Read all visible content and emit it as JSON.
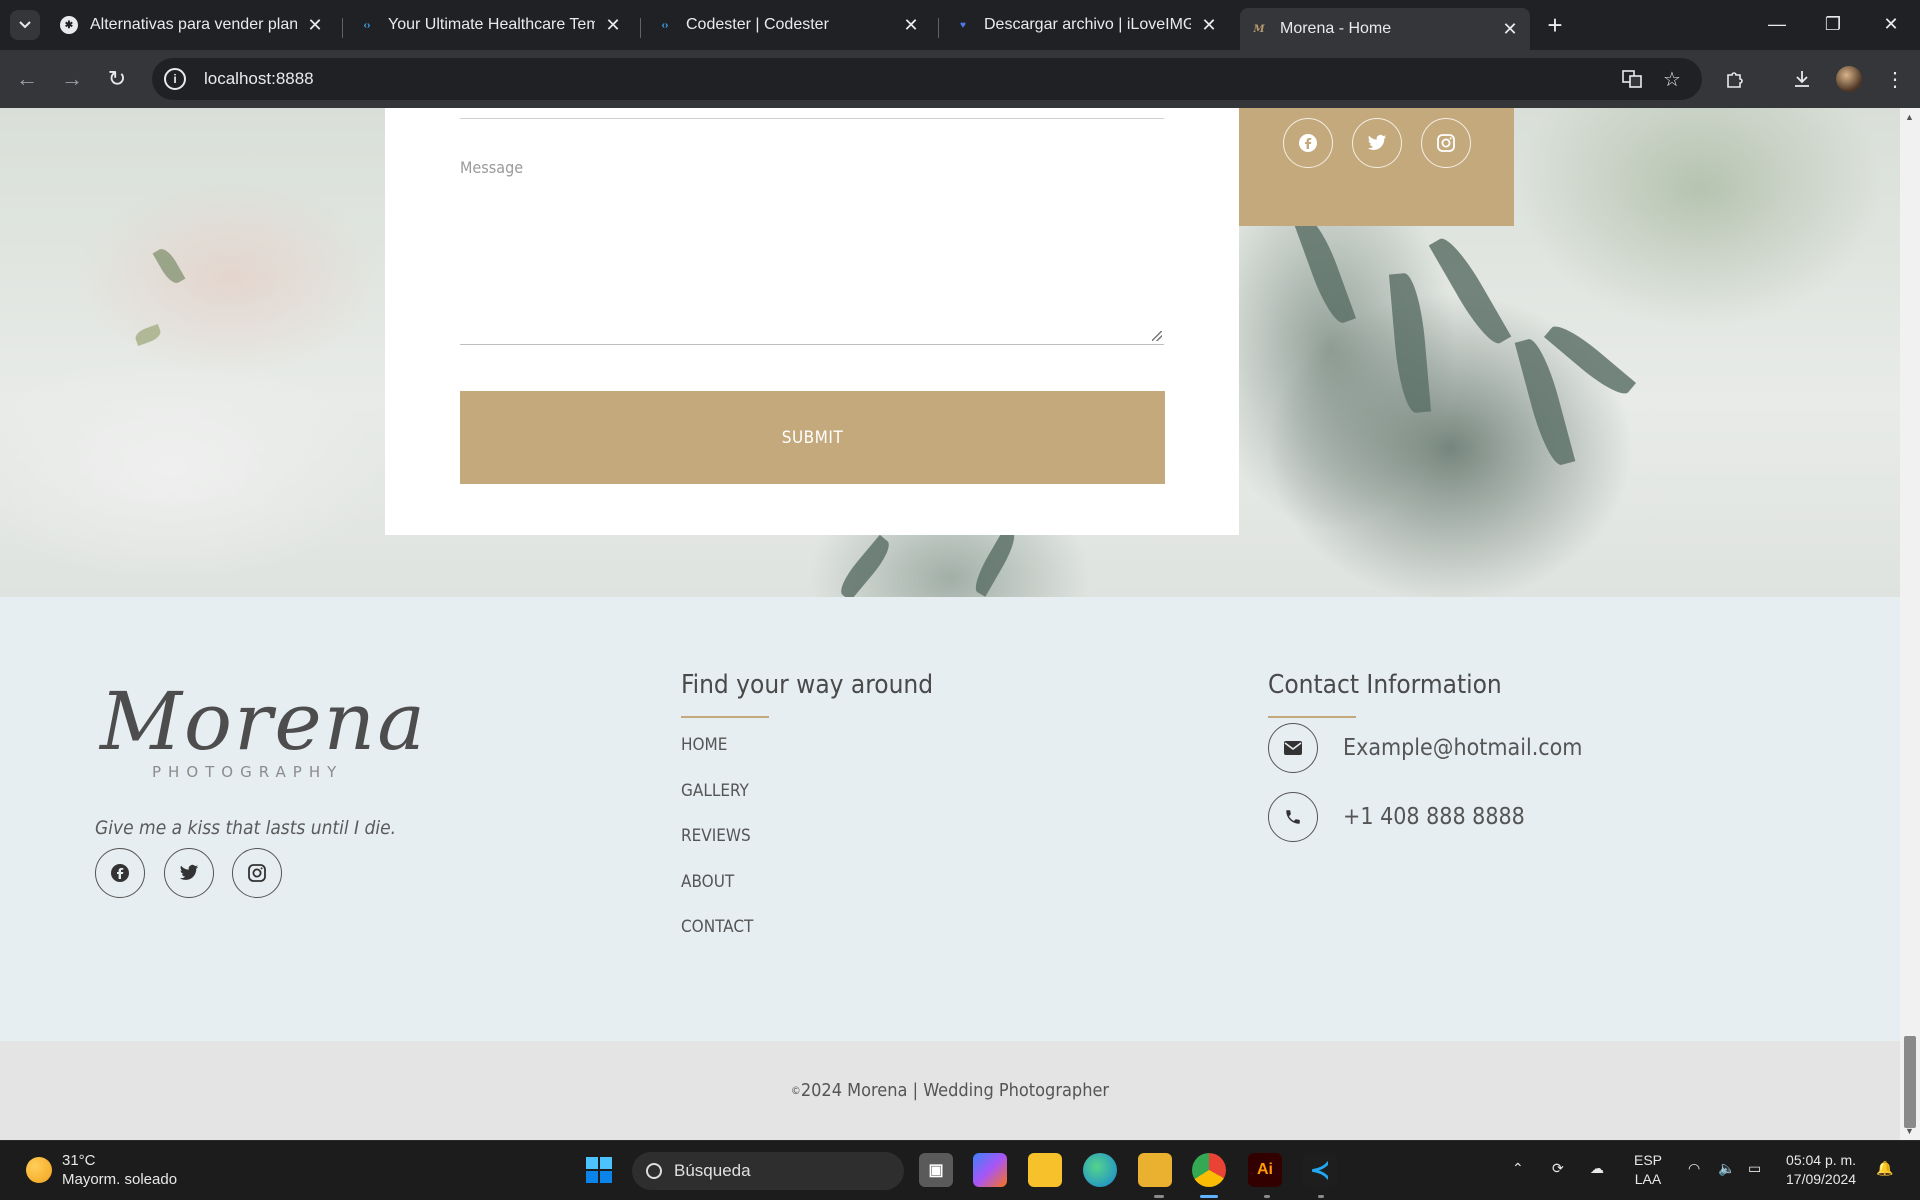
{
  "browser": {
    "tabs": [
      {
        "title": "Alternativas para vender plantill",
        "icon": "chatgpt-icon",
        "active": false
      },
      {
        "title": "Your Ultimate Healthcare Templ",
        "icon": "codester-icon",
        "active": false
      },
      {
        "title": "Codester | Codester",
        "icon": "codester-icon",
        "active": false
      },
      {
        "title": "Descargar archivo | iLoveIMG",
        "icon": "iloveimg-icon",
        "active": false
      },
      {
        "title": "Morena - Home",
        "icon": "morena-icon",
        "active": true
      }
    ],
    "url": "localhost:8888"
  },
  "form": {
    "message_placeholder": "Message",
    "submit_label": "SUBMIT"
  },
  "footer": {
    "logo": "Morena",
    "logo_sub": "PHOTOGRAPHY",
    "tagline": "Give me a kiss that lasts until I die.",
    "nav_title": "Find your way around",
    "nav_links": [
      "HOME",
      "GALLERY",
      "REVIEWS",
      "ABOUT",
      "CONTACT"
    ],
    "contact_title": "Contact Information",
    "email": "Example@hotmail.com",
    "phone": "+1 408 888 8888",
    "copyright_symbol": "©",
    "copyright": "2024 Morena | Wedding Photographer"
  },
  "colors": {
    "accent": "#c4a97c",
    "footer_bg": "#e6eef2",
    "copyright_bg": "#e4e4e4"
  },
  "taskbar": {
    "weather_temp": "31°C",
    "weather_desc": "Mayorm. soleado",
    "search_label": "Búsqueda",
    "lang_1": "ESP",
    "lang_2": "LAA",
    "time": "05:04 p. m.",
    "date": "17/09/2024"
  }
}
